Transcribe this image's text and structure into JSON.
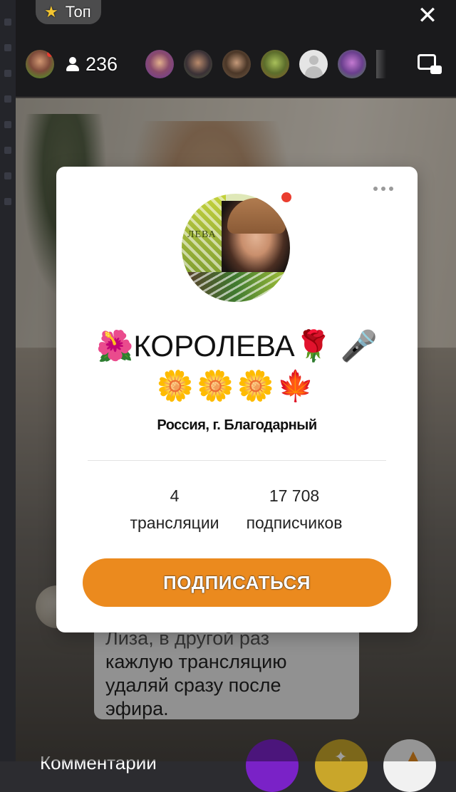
{
  "top_bar": {
    "top_label": "Топ",
    "viewer_count": "236"
  },
  "profile": {
    "name": "🌺КОРОЛЕВА🌹 🎤",
    "emoji_line": "🌼🌼🌼🍁",
    "location": "Россия, г. Благодарный",
    "avatar_text": "ЛЕВА",
    "stats": {
      "broadcasts_value": "4",
      "broadcasts_label": "трансляции",
      "subscribers_value": "17 708",
      "subscribers_label": "подписчиков"
    },
    "subscribe_label": "ПОДПИСАТЬСЯ"
  },
  "chat": {
    "lines": [
      "Лиза, в другой раз",
      "кажлую трансляцию",
      "удаляй сразу после",
      "эфира."
    ],
    "bottom_label": "Комментарии"
  },
  "colors": {
    "accent": "#eb8a1e",
    "online_dot": "#ea3d2f",
    "star": "#f3c531",
    "purple_button": "#7a22c7"
  },
  "icons": [
    "star-icon",
    "close-icon",
    "person-icon",
    "screen-mode-icon",
    "more-icon",
    "online-dot-icon"
  ]
}
